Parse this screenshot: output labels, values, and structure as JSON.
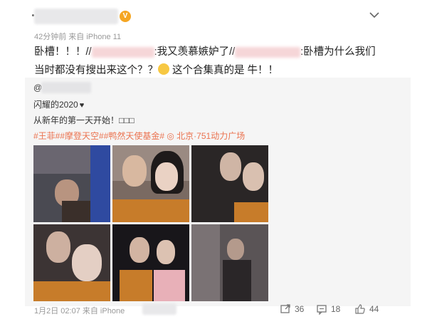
{
  "post": {
    "vip_badge": "V",
    "meta": "42分钟前 来自 iPhone 11",
    "text_line1_a": "卧槽！！！//",
    "text_line1_b": ":我又羡慕嫉妒了//",
    "text_line1_c": ":卧槽为什么我们",
    "text_line2": "当时都没有搜出来这个？？",
    "text_line2_b": "这个合集真的是 牛！！"
  },
  "repost": {
    "name_prefix": "@",
    "title": "闪耀的2020",
    "line2": "从新年的第一天开始！□□□",
    "tags": "#王菲##摩登天空##鸭然天使基金#  ◎ 北京·751动力广场"
  },
  "footer": {
    "time": "1月2日 02:07 来自 iPhone",
    "repost_count": "36",
    "comment_count": "18",
    "like_count": "44"
  },
  "colors": {
    "link": "#eb7350",
    "meta": "#999999",
    "repost_bg": "#f5f5f5"
  },
  "icons": [
    "chevron-down-icon",
    "repost-icon",
    "comment-icon",
    "like-icon",
    "location-icon",
    "heart-icon"
  ]
}
